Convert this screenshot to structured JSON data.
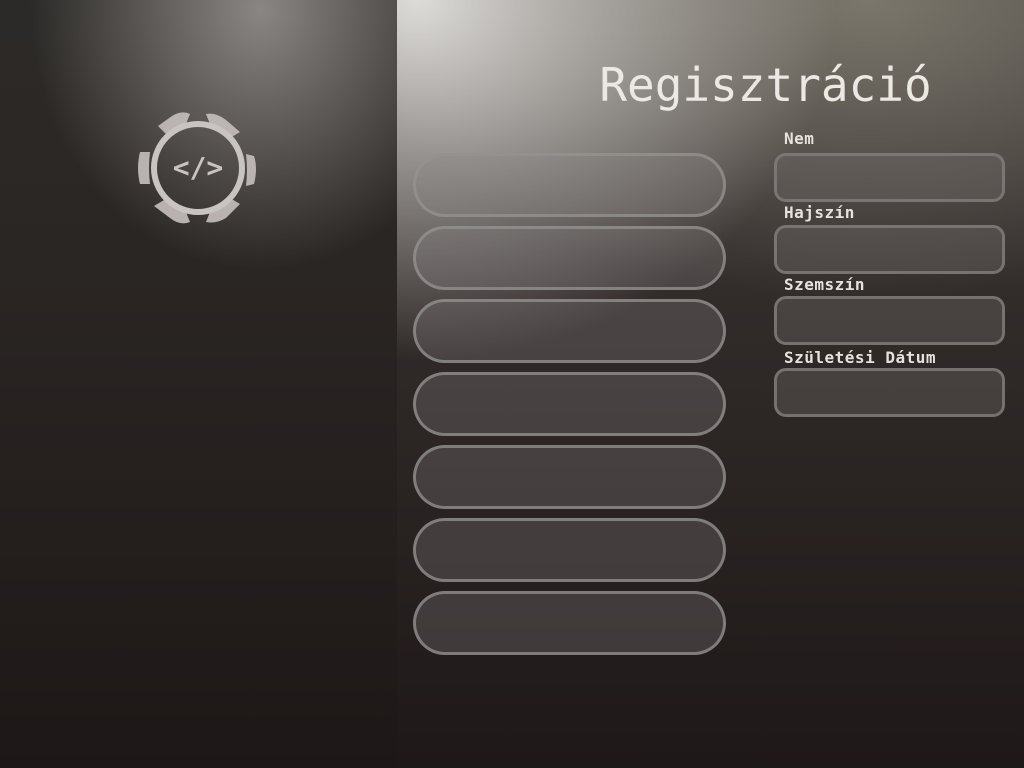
{
  "page": {
    "title": "Regisztráció"
  },
  "logo": {
    "icon": "code-gear-icon",
    "glyph": "</>"
  },
  "form": {
    "left_fields": [
      {
        "value": "",
        "placeholder": ""
      },
      {
        "value": "",
        "placeholder": ""
      },
      {
        "value": "",
        "placeholder": ""
      },
      {
        "value": "",
        "placeholder": ""
      },
      {
        "value": "",
        "placeholder": ""
      },
      {
        "value": "",
        "placeholder": ""
      },
      {
        "value": "",
        "placeholder": ""
      }
    ],
    "gender_label": "Nem",
    "gender_value": "",
    "hair_color_label": "Hajszín",
    "hair_color_value": "",
    "eye_color_label": "Szemszín",
    "eye_color_value": "",
    "birth_date_label": "Születési Dátum",
    "birth_date_value": ""
  },
  "colors": {
    "title": "#ece8e4",
    "label": "#e6e2de",
    "logo": "#c9c3c2",
    "background_dark": "#201a1a"
  }
}
